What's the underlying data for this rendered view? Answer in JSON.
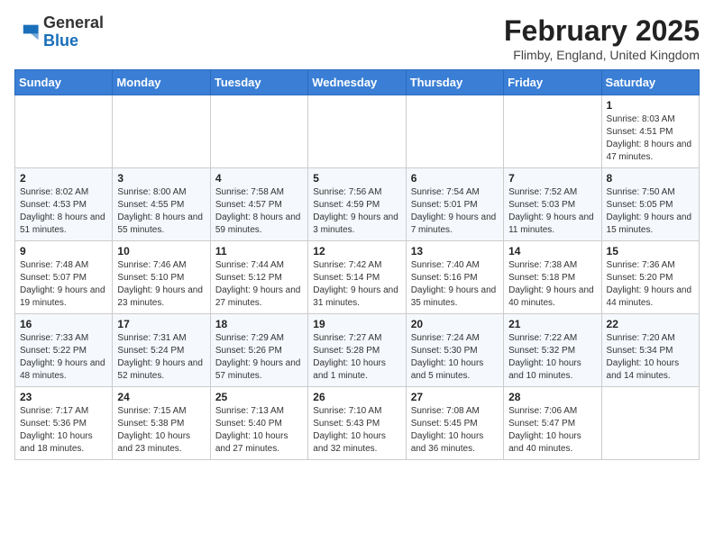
{
  "header": {
    "logo_general": "General",
    "logo_blue": "Blue",
    "month_title": "February 2025",
    "location": "Flimby, England, United Kingdom"
  },
  "weekdays": [
    "Sunday",
    "Monday",
    "Tuesday",
    "Wednesday",
    "Thursday",
    "Friday",
    "Saturday"
  ],
  "weeks": [
    [
      {
        "day": "",
        "info": ""
      },
      {
        "day": "",
        "info": ""
      },
      {
        "day": "",
        "info": ""
      },
      {
        "day": "",
        "info": ""
      },
      {
        "day": "",
        "info": ""
      },
      {
        "day": "",
        "info": ""
      },
      {
        "day": "1",
        "info": "Sunrise: 8:03 AM\nSunset: 4:51 PM\nDaylight: 8 hours and 47 minutes."
      }
    ],
    [
      {
        "day": "2",
        "info": "Sunrise: 8:02 AM\nSunset: 4:53 PM\nDaylight: 8 hours and 51 minutes."
      },
      {
        "day": "3",
        "info": "Sunrise: 8:00 AM\nSunset: 4:55 PM\nDaylight: 8 hours and 55 minutes."
      },
      {
        "day": "4",
        "info": "Sunrise: 7:58 AM\nSunset: 4:57 PM\nDaylight: 8 hours and 59 minutes."
      },
      {
        "day": "5",
        "info": "Sunrise: 7:56 AM\nSunset: 4:59 PM\nDaylight: 9 hours and 3 minutes."
      },
      {
        "day": "6",
        "info": "Sunrise: 7:54 AM\nSunset: 5:01 PM\nDaylight: 9 hours and 7 minutes."
      },
      {
        "day": "7",
        "info": "Sunrise: 7:52 AM\nSunset: 5:03 PM\nDaylight: 9 hours and 11 minutes."
      },
      {
        "day": "8",
        "info": "Sunrise: 7:50 AM\nSunset: 5:05 PM\nDaylight: 9 hours and 15 minutes."
      }
    ],
    [
      {
        "day": "9",
        "info": "Sunrise: 7:48 AM\nSunset: 5:07 PM\nDaylight: 9 hours and 19 minutes."
      },
      {
        "day": "10",
        "info": "Sunrise: 7:46 AM\nSunset: 5:10 PM\nDaylight: 9 hours and 23 minutes."
      },
      {
        "day": "11",
        "info": "Sunrise: 7:44 AM\nSunset: 5:12 PM\nDaylight: 9 hours and 27 minutes."
      },
      {
        "day": "12",
        "info": "Sunrise: 7:42 AM\nSunset: 5:14 PM\nDaylight: 9 hours and 31 minutes."
      },
      {
        "day": "13",
        "info": "Sunrise: 7:40 AM\nSunset: 5:16 PM\nDaylight: 9 hours and 35 minutes."
      },
      {
        "day": "14",
        "info": "Sunrise: 7:38 AM\nSunset: 5:18 PM\nDaylight: 9 hours and 40 minutes."
      },
      {
        "day": "15",
        "info": "Sunrise: 7:36 AM\nSunset: 5:20 PM\nDaylight: 9 hours and 44 minutes."
      }
    ],
    [
      {
        "day": "16",
        "info": "Sunrise: 7:33 AM\nSunset: 5:22 PM\nDaylight: 9 hours and 48 minutes."
      },
      {
        "day": "17",
        "info": "Sunrise: 7:31 AM\nSunset: 5:24 PM\nDaylight: 9 hours and 52 minutes."
      },
      {
        "day": "18",
        "info": "Sunrise: 7:29 AM\nSunset: 5:26 PM\nDaylight: 9 hours and 57 minutes."
      },
      {
        "day": "19",
        "info": "Sunrise: 7:27 AM\nSunset: 5:28 PM\nDaylight: 10 hours and 1 minute."
      },
      {
        "day": "20",
        "info": "Sunrise: 7:24 AM\nSunset: 5:30 PM\nDaylight: 10 hours and 5 minutes."
      },
      {
        "day": "21",
        "info": "Sunrise: 7:22 AM\nSunset: 5:32 PM\nDaylight: 10 hours and 10 minutes."
      },
      {
        "day": "22",
        "info": "Sunrise: 7:20 AM\nSunset: 5:34 PM\nDaylight: 10 hours and 14 minutes."
      }
    ],
    [
      {
        "day": "23",
        "info": "Sunrise: 7:17 AM\nSunset: 5:36 PM\nDaylight: 10 hours and 18 minutes."
      },
      {
        "day": "24",
        "info": "Sunrise: 7:15 AM\nSunset: 5:38 PM\nDaylight: 10 hours and 23 minutes."
      },
      {
        "day": "25",
        "info": "Sunrise: 7:13 AM\nSunset: 5:40 PM\nDaylight: 10 hours and 27 minutes."
      },
      {
        "day": "26",
        "info": "Sunrise: 7:10 AM\nSunset: 5:43 PM\nDaylight: 10 hours and 32 minutes."
      },
      {
        "day": "27",
        "info": "Sunrise: 7:08 AM\nSunset: 5:45 PM\nDaylight: 10 hours and 36 minutes."
      },
      {
        "day": "28",
        "info": "Sunrise: 7:06 AM\nSunset: 5:47 PM\nDaylight: 10 hours and 40 minutes."
      },
      {
        "day": "",
        "info": ""
      }
    ]
  ]
}
